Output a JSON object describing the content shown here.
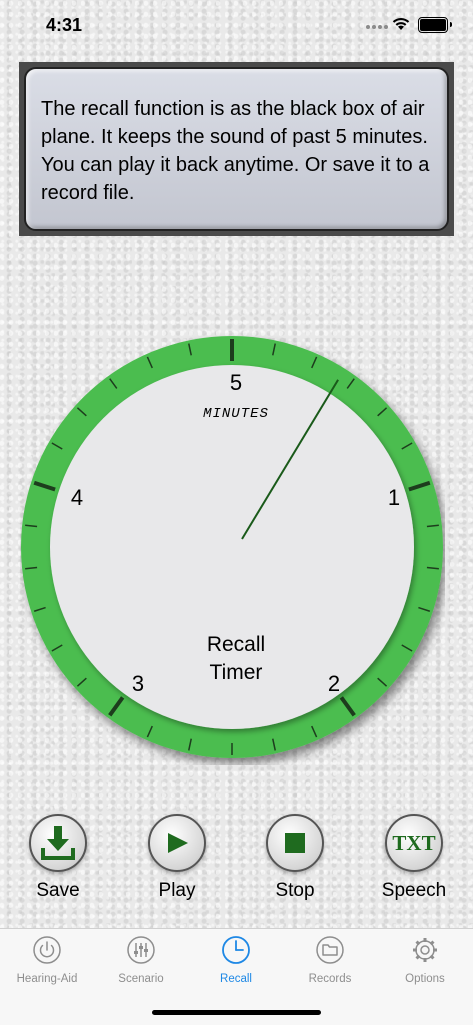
{
  "status_bar": {
    "time": "4:31",
    "icons": [
      "cellular-icon",
      "wifi-icon",
      "battery-icon"
    ]
  },
  "info_panel": {
    "text": "The recall function is as the black box of air plane. It keeps the sound of past 5 minutes. You can play it back anytime. Or save it to a record file."
  },
  "dial": {
    "unit_label": "MINUTES",
    "center_label_line1": "Recall",
    "center_label_line2": "Timer",
    "numbers": [
      "5",
      "1",
      "2",
      "3",
      "4"
    ],
    "hand_value_minutes": 0.45,
    "ring_color": "#4cbd50",
    "face_color": "#e8e8ea",
    "hand_color": "#1a5a1a"
  },
  "controls": [
    {
      "label": "Save",
      "icon": "download-icon"
    },
    {
      "label": "Play",
      "icon": "play-icon"
    },
    {
      "label": "Stop",
      "icon": "stop-icon"
    },
    {
      "label": "Speech",
      "icon": "txt-icon",
      "glyph": "TXT"
    }
  ],
  "tabs": [
    {
      "label": "Hearing-Aid",
      "icon": "power-icon",
      "active": false
    },
    {
      "label": "Scenario",
      "icon": "sliders-icon",
      "active": false
    },
    {
      "label": "Recall",
      "icon": "clock-icon",
      "active": true
    },
    {
      "label": "Records",
      "icon": "folder-icon",
      "active": false
    },
    {
      "label": "Options",
      "icon": "gear-icon",
      "active": false
    }
  ],
  "colors": {
    "accent_green": "#1f6b1f",
    "tab_active": "#1e88e5",
    "tab_inactive": "#8e8e8e"
  }
}
